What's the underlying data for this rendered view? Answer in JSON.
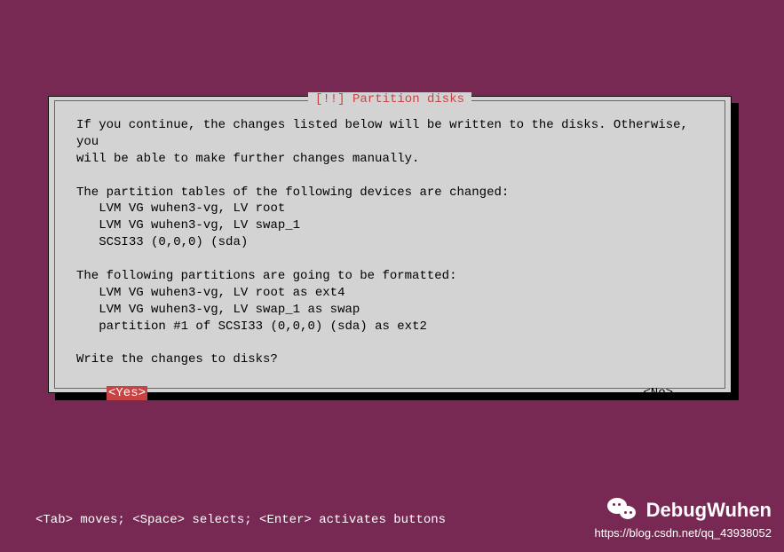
{
  "dialog": {
    "title_prefix": "[!!]",
    "title": "Partition disks",
    "body": "If you continue, the changes listed below will be written to the disks. Otherwise, you\nwill be able to make further changes manually.\n\nThe partition tables of the following devices are changed:\n   LVM VG wuhen3-vg, LV root\n   LVM VG wuhen3-vg, LV swap_1\n   SCSI33 (0,0,0) (sda)\n\nThe following partitions are going to be formatted:\n   LVM VG wuhen3-vg, LV root as ext4\n   LVM VG wuhen3-vg, LV swap_1 as swap\n   partition #1 of SCSI33 (0,0,0) (sda) as ext2\n\nWrite the changes to disks?",
    "yes_label": "<Yes>",
    "no_label": "<No>"
  },
  "help_bar": "<Tab> moves; <Space> selects; <Enter> activates buttons",
  "watermark": {
    "name": "DebugWuhen",
    "url": "https://blog.csdn.net/qq_43938052"
  }
}
